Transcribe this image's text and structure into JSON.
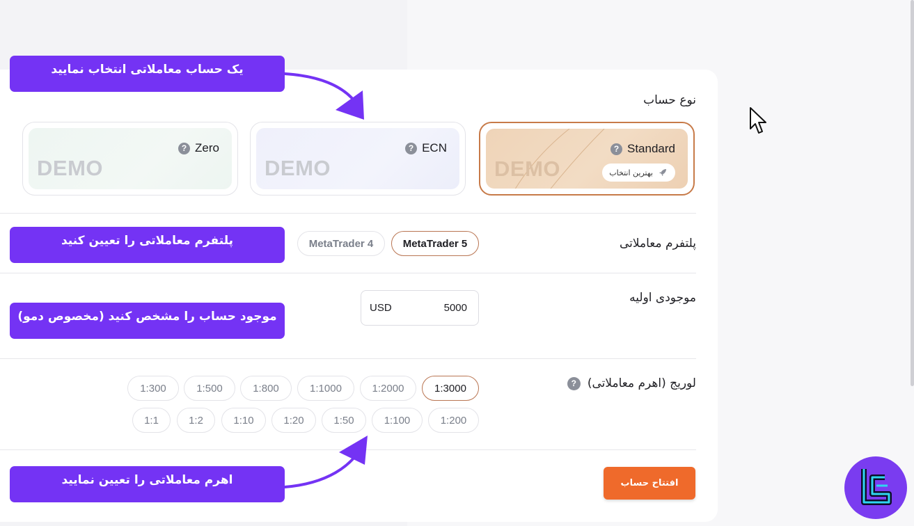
{
  "account_type": {
    "label": "نوع حساب",
    "cards": [
      {
        "name": "Standard",
        "demo": "DEMO",
        "badge": "بهترین انتخاب",
        "selected": true
      },
      {
        "name": "ECN",
        "demo": "DEMO",
        "selected": false
      },
      {
        "name": "Zero",
        "demo": "DEMO",
        "selected": false
      }
    ]
  },
  "platform": {
    "label": "پلتفرم معاملاتی",
    "options": [
      {
        "label": "MetaTrader 5",
        "selected": true
      },
      {
        "label": "MetaTrader 4",
        "selected": false
      }
    ]
  },
  "balance": {
    "label": "موجودی اولیه",
    "currency": "USD",
    "amount": "5000"
  },
  "leverage": {
    "label": "لوریج (اهرم معاملاتی)",
    "row1": [
      "1:3000",
      "1:2000",
      "1:1000",
      "1:800",
      "1:500",
      "1:300"
    ],
    "row2": [
      "1:200",
      "1:100",
      "1:50",
      "1:20",
      "1:10",
      "1:2",
      "1:1"
    ],
    "selected": "1:3000"
  },
  "open_account_label": "افتتاح حساب",
  "callouts": {
    "select_account": "یک حساب معاملاتی انتخاب نمایید",
    "select_platform": "پلتفرم معاملاتی را تعیین کنید",
    "set_balance": "موجود حساب را مشخص کنید (مخصوص دمو)",
    "set_leverage": "اهرم معاملاتی را تعیین نمایید"
  },
  "colors": {
    "accent": "#ef6a2b",
    "callout": "#7433f4",
    "selected_border": "#c77a48",
    "logo": "#7a3cf0",
    "logo_stroke": "#2fd6f0"
  },
  "icons": [
    "question-icon",
    "rocket-icon",
    "mouse-pointer-icon",
    "brand-logo",
    "arrow-icon"
  ]
}
